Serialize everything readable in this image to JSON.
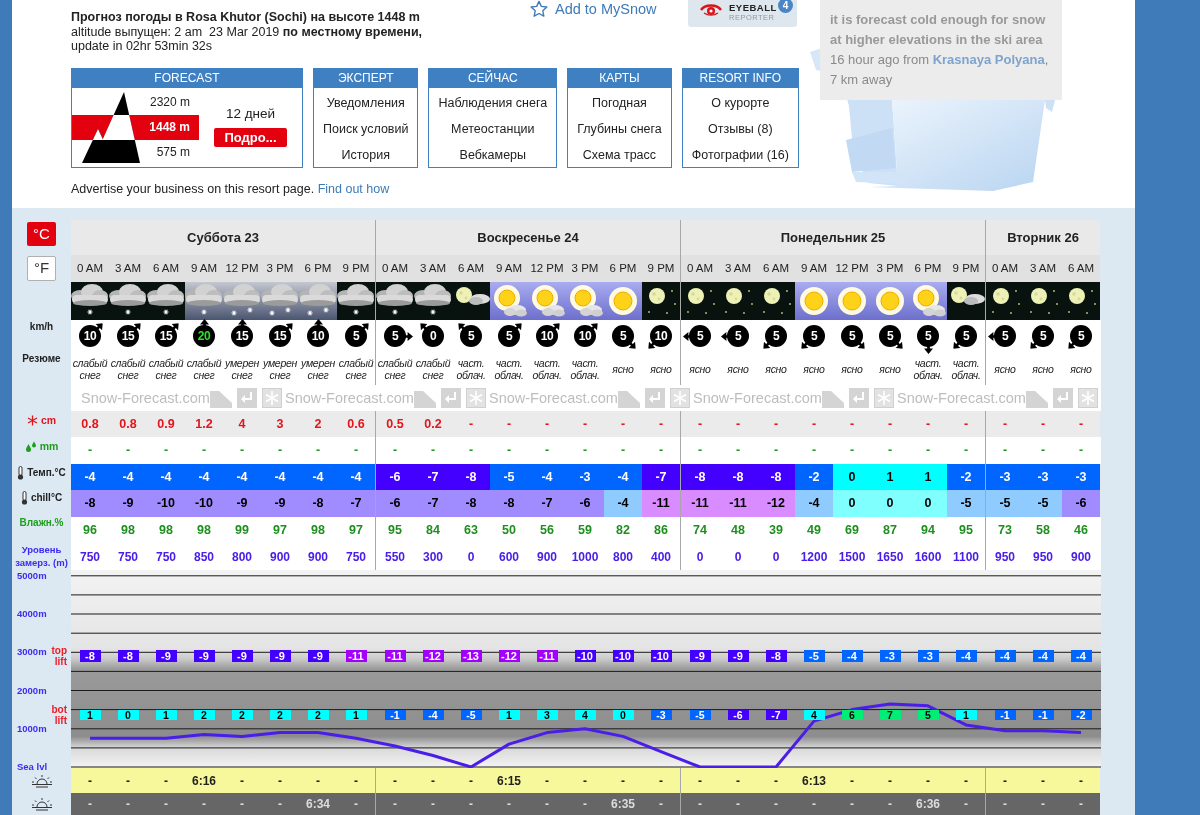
{
  "title": "**Прогноз погоды в Rosa Khutor (Sochi) на высоте 1448 m** altitude выпущен: 2 am  23 Mar 2019 **по местному времени,** update in 02hr 53min 32s",
  "add_to_mysnow": "Add to MySnow",
  "eyeball": {
    "title": "EYEBALL",
    "subtitle": "REPORTER",
    "count": "4"
  },
  "report": {
    "text": "it is forecast cold enough for snow at higher elevations in the ski area",
    "time": "16 hour ago from",
    "place": "Krasnaya Polyana",
    "distance": ", 7 km away"
  },
  "nav": {
    "forecast": {
      "header": "FORECAST",
      "elevations": [
        {
          "label": "2320 m",
          "selected": false
        },
        {
          "label": "1448 m",
          "selected": true
        },
        {
          "label": "575 m",
          "selected": false
        }
      ],
      "days": "12 дней",
      "button": "Подро..."
    },
    "menus": [
      {
        "header": "ЭКСПЕРТ",
        "links": [
          "Уведомления",
          "Поиск условий",
          "История"
        ]
      },
      {
        "header": "СЕЙЧАС",
        "links": [
          "Наблюдения снега",
          "Метеостанции",
          "Вебкамеры"
        ]
      },
      {
        "header": "КАРТЫ",
        "links": [
          "Погодная",
          "Глубины снега",
          "Схема трасс"
        ]
      },
      {
        "header": "RESORT INFO",
        "links": [
          "О курорте",
          "Отзывы (8)",
          "Фотографии (16)"
        ]
      }
    ]
  },
  "advertise": {
    "text": "Advertise your business on this resort page.",
    "link": "Find out how"
  },
  "forecast_table": {
    "units": [
      {
        "label": "°C",
        "selected": true
      },
      {
        "label": "°F",
        "selected": false
      }
    ],
    "row_labels": {
      "wind": "km/h",
      "summary": "Резюме",
      "snow": "cm",
      "rain": "mm",
      "temp": "Темп.°C",
      "chill": "chill°C",
      "humidity": "Влажн.%",
      "freezing": "Уровень замерз. (m)"
    },
    "brand_strip": [
      "Snow-Forecast.com",
      "Snow-Forecast.com",
      "Snow-Forecast.com",
      "Snow-Forecast.com",
      "Snow-Forecast.com"
    ],
    "days": [
      {
        "label": "Суббота 23",
        "periods": [
          {
            "time": "0 AM",
            "kind": "snow_night",
            "wind": {
              "text": "10",
              "kind": "northeast",
              "strong": false
            },
            "summary": "слабый снег",
            "snow": "0.8",
            "rain": "-",
            "temp": {
              "text": "-4",
              "color": "#0066ff"
            },
            "chill": {
              "text": "-8",
              "color": "#a08cff"
            },
            "humidity": "96",
            "freezing": "750",
            "top_lift": {
              "text": "-8",
              "color": "#4400ff"
            },
            "bottom_lift": {
              "text": "1",
              "color": "#00ffff"
            },
            "sunrise": "-",
            "sunset": "-"
          },
          {
            "time": "3 AM",
            "kind": "snow_night",
            "wind": {
              "text": "15",
              "kind": "northeast",
              "strong": false
            },
            "summary": "слабый снег",
            "snow": "0.8",
            "rain": "-",
            "temp": {
              "text": "-4",
              "color": "#0066ff"
            },
            "chill": {
              "text": "-9",
              "color": "#a08cff"
            },
            "humidity": "98",
            "freezing": "750",
            "top_lift": {
              "text": "-8",
              "color": "#4400ff"
            },
            "bottom_lift": {
              "text": "0",
              "color": "#00ffff"
            },
            "sunrise": "-",
            "sunset": "-"
          },
          {
            "time": "6 AM",
            "kind": "snow_night",
            "wind": {
              "text": "15",
              "kind": "northeast",
              "strong": false
            },
            "summary": "слабый снег",
            "snow": "0.9",
            "rain": "-",
            "temp": {
              "text": "-4",
              "color": "#0066ff"
            },
            "chill": {
              "text": "-10",
              "color": "#a08cff"
            },
            "humidity": "98",
            "freezing": "750",
            "top_lift": {
              "text": "-9",
              "color": "#4400ff"
            },
            "bottom_lift": {
              "text": "1",
              "color": "#00ffff"
            },
            "sunrise": "-",
            "sunset": "-"
          },
          {
            "time": "9 AM",
            "kind": "light_snow_day",
            "wind": {
              "text": "20",
              "kind": "north",
              "strong": true
            },
            "summary": "слабый снег",
            "snow": "1.2",
            "rain": "-",
            "temp": {
              "text": "-4",
              "color": "#0066ff"
            },
            "chill": {
              "text": "-10",
              "color": "#a08cff"
            },
            "humidity": "98",
            "freezing": "850",
            "top_lift": {
              "text": "-9",
              "color": "#4400ff"
            },
            "bottom_lift": {
              "text": "2",
              "color": "#00ffff"
            },
            "sunrise": "6:16",
            "sunset": "-"
          },
          {
            "time": "12 PM",
            "kind": "snow_day",
            "wind": {
              "text": "15",
              "kind": "north",
              "strong": false
            },
            "summary": "умерен снег",
            "snow": "4",
            "rain": "-",
            "temp": {
              "text": "-4",
              "color": "#0066ff"
            },
            "chill": {
              "text": "-9",
              "color": "#a08cff"
            },
            "humidity": "99",
            "freezing": "800",
            "top_lift": {
              "text": "-9",
              "color": "#4400ff"
            },
            "bottom_lift": {
              "text": "2",
              "color": "#00ffff"
            },
            "sunrise": "-",
            "sunset": "-"
          },
          {
            "time": "3 PM",
            "kind": "snow_day",
            "wind": {
              "text": "15",
              "kind": "northeast",
              "strong": false
            },
            "summary": "умерен снег",
            "snow": "3",
            "rain": "-",
            "temp": {
              "text": "-4",
              "color": "#0066ff"
            },
            "chill": {
              "text": "-9",
              "color": "#a08cff"
            },
            "humidity": "97",
            "freezing": "900",
            "top_lift": {
              "text": "-9",
              "color": "#4400ff"
            },
            "bottom_lift": {
              "text": "2",
              "color": "#00ffff"
            },
            "sunrise": "-",
            "sunset": "-"
          },
          {
            "time": "6 PM",
            "kind": "snow_day",
            "wind": {
              "text": "10",
              "kind": "north",
              "strong": false
            },
            "summary": "умерен снег",
            "snow": "2",
            "rain": "-",
            "temp": {
              "text": "-4",
              "color": "#0066ff"
            },
            "chill": {
              "text": "-8",
              "color": "#a08cff"
            },
            "humidity": "98",
            "freezing": "900",
            "top_lift": {
              "text": "-9",
              "color": "#4400ff"
            },
            "bottom_lift": {
              "text": "2",
              "color": "#00ffff"
            },
            "sunrise": "-",
            "sunset": "6:34"
          },
          {
            "time": "9 PM",
            "kind": "snow_night",
            "wind": {
              "text": "5",
              "kind": "northeast",
              "strong": false
            },
            "summary": "слабый снег",
            "snow": "0.6",
            "rain": "-",
            "temp": {
              "text": "-4",
              "color": "#0066ff"
            },
            "chill": {
              "text": "-7",
              "color": "#a08cff"
            },
            "humidity": "97",
            "freezing": "750",
            "top_lift": {
              "text": "-11",
              "color": "#a100ff"
            },
            "bottom_lift": {
              "text": "1",
              "color": "#00ffff"
            },
            "sunrise": "-",
            "sunset": "-"
          }
        ]
      },
      {
        "label": "Воскресенье 24",
        "periods": [
          {
            "time": "0 AM",
            "kind": "snow_night",
            "wind": {
              "text": "5",
              "kind": "east",
              "strong": false
            },
            "summary": "слабый снег",
            "snow": "0.5",
            "rain": "-",
            "temp": {
              "text": "-6",
              "color": "#4400ff"
            },
            "chill": {
              "text": "-6",
              "color": "#a08cff"
            },
            "humidity": "95",
            "freezing": "550",
            "top_lift": {
              "text": "-11",
              "color": "#a100ff"
            },
            "bottom_lift": {
              "text": "-1",
              "color": "#0066ff"
            },
            "sunrise": "-",
            "sunset": "-"
          },
          {
            "time": "3 AM",
            "kind": "snow_night",
            "wind": {
              "text": "0",
              "kind": "northwest",
              "strong": false
            },
            "summary": "слабый снег",
            "snow": "0.2",
            "rain": "-",
            "temp": {
              "text": "-7",
              "color": "#4400ff"
            },
            "chill": {
              "text": "-7",
              "color": "#a08cff"
            },
            "humidity": "84",
            "freezing": "300",
            "top_lift": {
              "text": "-12",
              "color": "#a100ff"
            },
            "bottom_lift": {
              "text": "-4",
              "color": "#0066ff"
            },
            "sunrise": "-",
            "sunset": "-"
          },
          {
            "time": "6 AM",
            "kind": "moon_cloud",
            "wind": {
              "text": "5",
              "kind": "northwest",
              "strong": false
            },
            "summary": "част. облач.",
            "snow": "-",
            "rain": "-",
            "temp": {
              "text": "-8",
              "color": "#4400ff"
            },
            "chill": {
              "text": "-8",
              "color": "#a08cff"
            },
            "humidity": "63",
            "freezing": "0",
            "top_lift": {
              "text": "-13",
              "color": "#a100ff"
            },
            "bottom_lift": {
              "text": "-5",
              "color": "#0066ff"
            },
            "sunrise": "-",
            "sunset": "-"
          },
          {
            "time": "9 AM",
            "kind": "sun_cloud",
            "wind": {
              "text": "5",
              "kind": "northeast",
              "strong": false
            },
            "summary": "част. облач.",
            "snow": "-",
            "rain": "-",
            "temp": {
              "text": "-5",
              "color": "#0066ff"
            },
            "chill": {
              "text": "-8",
              "color": "#a08cff"
            },
            "humidity": "50",
            "freezing": "600",
            "top_lift": {
              "text": "-12",
              "color": "#a100ff"
            },
            "bottom_lift": {
              "text": "1",
              "color": "#00ffff"
            },
            "sunrise": "6:15",
            "sunset": "-"
          },
          {
            "time": "12 PM",
            "kind": "sun_cloud",
            "wind": {
              "text": "10",
              "kind": "northeast",
              "strong": false
            },
            "summary": "част. облач.",
            "snow": "-",
            "rain": "-",
            "temp": {
              "text": "-4",
              "color": "#0066ff"
            },
            "chill": {
              "text": "-7",
              "color": "#a08cff"
            },
            "humidity": "56",
            "freezing": "900",
            "top_lift": {
              "text": "-11",
              "color": "#a100ff"
            },
            "bottom_lift": {
              "text": "3",
              "color": "#00ffff"
            },
            "sunrise": "-",
            "sunset": "-"
          },
          {
            "time": "3 PM",
            "kind": "sun_cloud",
            "wind": {
              "text": "10",
              "kind": "northeast",
              "strong": false
            },
            "summary": "част. облач.",
            "snow": "-",
            "rain": "-",
            "temp": {
              "text": "-3",
              "color": "#0066ff"
            },
            "chill": {
              "text": "-6",
              "color": "#a08cff"
            },
            "humidity": "59",
            "freezing": "1000",
            "top_lift": {
              "text": "-10",
              "color": "#4400ff"
            },
            "bottom_lift": {
              "text": "4",
              "color": "#00ffff"
            },
            "sunrise": "-",
            "sunset": "-"
          },
          {
            "time": "6 PM",
            "kind": "sun",
            "wind": {
              "text": "5",
              "kind": "southeast",
              "strong": false
            },
            "summary": "ясно",
            "snow": "-",
            "rain": "-",
            "temp": {
              "text": "-4",
              "color": "#0066ff"
            },
            "chill": {
              "text": "-4",
              "color": "#8fcbff"
            },
            "humidity": "82",
            "freezing": "800",
            "top_lift": {
              "text": "-10",
              "color": "#4400ff"
            },
            "bottom_lift": {
              "text": "0",
              "color": "#00ffff"
            },
            "sunrise": "-",
            "sunset": "6:35"
          },
          {
            "time": "9 PM",
            "kind": "moon",
            "wind": {
              "text": "10",
              "kind": "southwest",
              "strong": false
            },
            "summary": "ясно",
            "snow": "-",
            "rain": "-",
            "temp": {
              "text": "-7",
              "color": "#4400ff"
            },
            "chill": {
              "text": "-11",
              "color": "#d98cff"
            },
            "humidity": "86",
            "freezing": "400",
            "top_lift": {
              "text": "-10",
              "color": "#4400ff"
            },
            "bottom_lift": {
              "text": "-3",
              "color": "#0066ff"
            },
            "sunrise": "-",
            "sunset": "-"
          }
        ]
      },
      {
        "label": "Понедельник 25",
        "periods": [
          {
            "time": "0 AM",
            "kind": "moon",
            "wind": {
              "text": "5",
              "kind": "west",
              "strong": false
            },
            "summary": "ясно",
            "snow": "-",
            "rain": "-",
            "temp": {
              "text": "-8",
              "color": "#4400ff"
            },
            "chill": {
              "text": "-11",
              "color": "#d98cff"
            },
            "humidity": "74",
            "freezing": "0",
            "top_lift": {
              "text": "-9",
              "color": "#4400ff"
            },
            "bottom_lift": {
              "text": "-5",
              "color": "#0066ff"
            },
            "sunrise": "-",
            "sunset": "-"
          },
          {
            "time": "3 AM",
            "kind": "moon",
            "wind": {
              "text": "5",
              "kind": "west",
              "strong": false
            },
            "summary": "ясно",
            "snow": "-",
            "rain": "-",
            "temp": {
              "text": "-8",
              "color": "#4400ff"
            },
            "chill": {
              "text": "-11",
              "color": "#d98cff"
            },
            "humidity": "48",
            "freezing": "0",
            "top_lift": {
              "text": "-9",
              "color": "#4400ff"
            },
            "bottom_lift": {
              "text": "-6",
              "color": "#4400ff"
            },
            "sunrise": "-",
            "sunset": "-"
          },
          {
            "time": "6 AM",
            "kind": "moon",
            "wind": {
              "text": "5",
              "kind": "southwest",
              "strong": false
            },
            "summary": "ясно",
            "snow": "-",
            "rain": "-",
            "temp": {
              "text": "-8",
              "color": "#4400ff"
            },
            "chill": {
              "text": "-12",
              "color": "#d98cff"
            },
            "humidity": "39",
            "freezing": "0",
            "top_lift": {
              "text": "-8",
              "color": "#4400ff"
            },
            "bottom_lift": {
              "text": "-7",
              "color": "#4400ff"
            },
            "sunrise": "-",
            "sunset": "-"
          },
          {
            "time": "9 AM",
            "kind": "sun",
            "wind": {
              "text": "5",
              "kind": "southwest",
              "strong": false
            },
            "summary": "ясно",
            "snow": "-",
            "rain": "-",
            "temp": {
              "text": "-2",
              "color": "#0066ff"
            },
            "chill": {
              "text": "-4",
              "color": "#8fcbff"
            },
            "humidity": "49",
            "freezing": "1200",
            "top_lift": {
              "text": "-5",
              "color": "#0066ff"
            },
            "bottom_lift": {
              "text": "4",
              "color": "#00ffff"
            },
            "sunrise": "6:13",
            "sunset": "-"
          },
          {
            "time": "12 PM",
            "kind": "sun",
            "wind": {
              "text": "5",
              "kind": "southeast",
              "strong": false
            },
            "summary": "ясно",
            "snow": "-",
            "rain": "-",
            "temp": {
              "text": "0",
              "color": "#00ffff"
            },
            "chill": {
              "text": "0",
              "color": "#80ffff"
            },
            "humidity": "69",
            "freezing": "1500",
            "top_lift": {
              "text": "-4",
              "color": "#0066ff"
            },
            "bottom_lift": {
              "text": "6",
              "color": "#00ee76"
            },
            "sunrise": "-",
            "sunset": "-"
          },
          {
            "time": "3 PM",
            "kind": "sun",
            "wind": {
              "text": "5",
              "kind": "southeast",
              "strong": false
            },
            "summary": "ясно",
            "snow": "-",
            "rain": "-",
            "temp": {
              "text": "1",
              "color": "#00ffff"
            },
            "chill": {
              "text": "0",
              "color": "#80ffff"
            },
            "humidity": "87",
            "freezing": "1650",
            "top_lift": {
              "text": "-3",
              "color": "#0066ff"
            },
            "bottom_lift": {
              "text": "7",
              "color": "#00ee76"
            },
            "sunrise": "-",
            "sunset": "-"
          },
          {
            "time": "6 PM",
            "kind": "sun_cloud",
            "wind": {
              "text": "5",
              "kind": "south",
              "strong": false
            },
            "summary": "част. облач.",
            "snow": "-",
            "rain": "-",
            "temp": {
              "text": "1",
              "color": "#00ffff"
            },
            "chill": {
              "text": "0",
              "color": "#80ffff"
            },
            "humidity": "94",
            "freezing": "1600",
            "top_lift": {
              "text": "-3",
              "color": "#0066ff"
            },
            "bottom_lift": {
              "text": "5",
              "color": "#00ee76"
            },
            "sunrise": "-",
            "sunset": "6:36"
          },
          {
            "time": "9 PM",
            "kind": "moon_cloud",
            "wind": {
              "text": "5",
              "kind": "southwest",
              "strong": false
            },
            "summary": "част. облач.",
            "snow": "-",
            "rain": "-",
            "temp": {
              "text": "-2",
              "color": "#0066ff"
            },
            "chill": {
              "text": "-5",
              "color": "#8fcbff"
            },
            "humidity": "95",
            "freezing": "1100",
            "top_lift": {
              "text": "-4",
              "color": "#0066ff"
            },
            "bottom_lift": {
              "text": "1",
              "color": "#00ffff"
            },
            "sunrise": "-",
            "sunset": "-"
          }
        ]
      },
      {
        "label": "Вторник 26",
        "periods": [
          {
            "time": "0 AM",
            "kind": "moon",
            "wind": {
              "text": "5",
              "kind": "west",
              "strong": false
            },
            "summary": "ясно",
            "snow": "-",
            "rain": "-",
            "temp": {
              "text": "-3",
              "color": "#0066ff"
            },
            "chill": {
              "text": "-5",
              "color": "#8fcbff"
            },
            "humidity": "73",
            "freezing": "950",
            "top_lift": {
              "text": "-4",
              "color": "#0066ff"
            },
            "bottom_lift": {
              "text": "-1",
              "color": "#0066ff"
            },
            "sunrise": "-",
            "sunset": "-"
          },
          {
            "time": "3 AM",
            "kind": "moon",
            "wind": {
              "text": "5",
              "kind": "southwest",
              "strong": false
            },
            "summary": "ясно",
            "snow": "-",
            "rain": "-",
            "temp": {
              "text": "-3",
              "color": "#0066ff"
            },
            "chill": {
              "text": "-5",
              "color": "#8fcbff"
            },
            "humidity": "58",
            "freezing": "950",
            "top_lift": {
              "text": "-4",
              "color": "#0066ff"
            },
            "bottom_lift": {
              "text": "-1",
              "color": "#0066ff"
            },
            "sunrise": "-",
            "sunset": "-"
          },
          {
            "time": "6 AM",
            "kind": "moon",
            "wind": {
              "text": "5",
              "kind": "southwest",
              "strong": false
            },
            "summary": "ясно",
            "snow": "-",
            "rain": "-",
            "temp": {
              "text": "-3",
              "color": "#0066ff"
            },
            "chill": {
              "text": "-6",
              "color": "#a08cff"
            },
            "humidity": "46",
            "freezing": "900",
            "top_lift": {
              "text": "-4",
              "color": "#0066ff"
            },
            "bottom_lift": {
              "text": "-2",
              "color": "#0066ff"
            },
            "sunrise": "-",
            "sunset": "-"
          }
        ]
      }
    ],
    "chart": {
      "chart_data": {
        "type": "line",
        "ylim": [
          0,
          5000
        ],
        "yticks": [
          {
            "value": 5000,
            "label": "5000m"
          },
          {
            "value": 4000,
            "label": "4000m"
          },
          {
            "value": 3000,
            "label": "3000m"
          },
          {
            "value": 2000,
            "label": "2000m"
          },
          {
            "value": 1000,
            "label": "1000m"
          },
          {
            "value": 0,
            "label": "Sea lvl"
          }
        ],
        "grid": true,
        "series": [
          {
            "color": "#4a1ee8",
            "values": [
              750,
              750,
              750,
              850,
              800,
              900,
              900,
              750,
              550,
              300,
              0,
              600,
              900,
              1000,
              800,
              400,
              0,
              0,
              0,
              1200,
              1500,
              1650,
              1600,
              1100,
              950,
              950,
              900
            ]
          }
        ]
      },
      "lift_labels": [
        {
          "kind": "top",
          "text": "top lift"
        },
        {
          "kind": "bottom",
          "text": "bot lift"
        }
      ]
    }
  }
}
